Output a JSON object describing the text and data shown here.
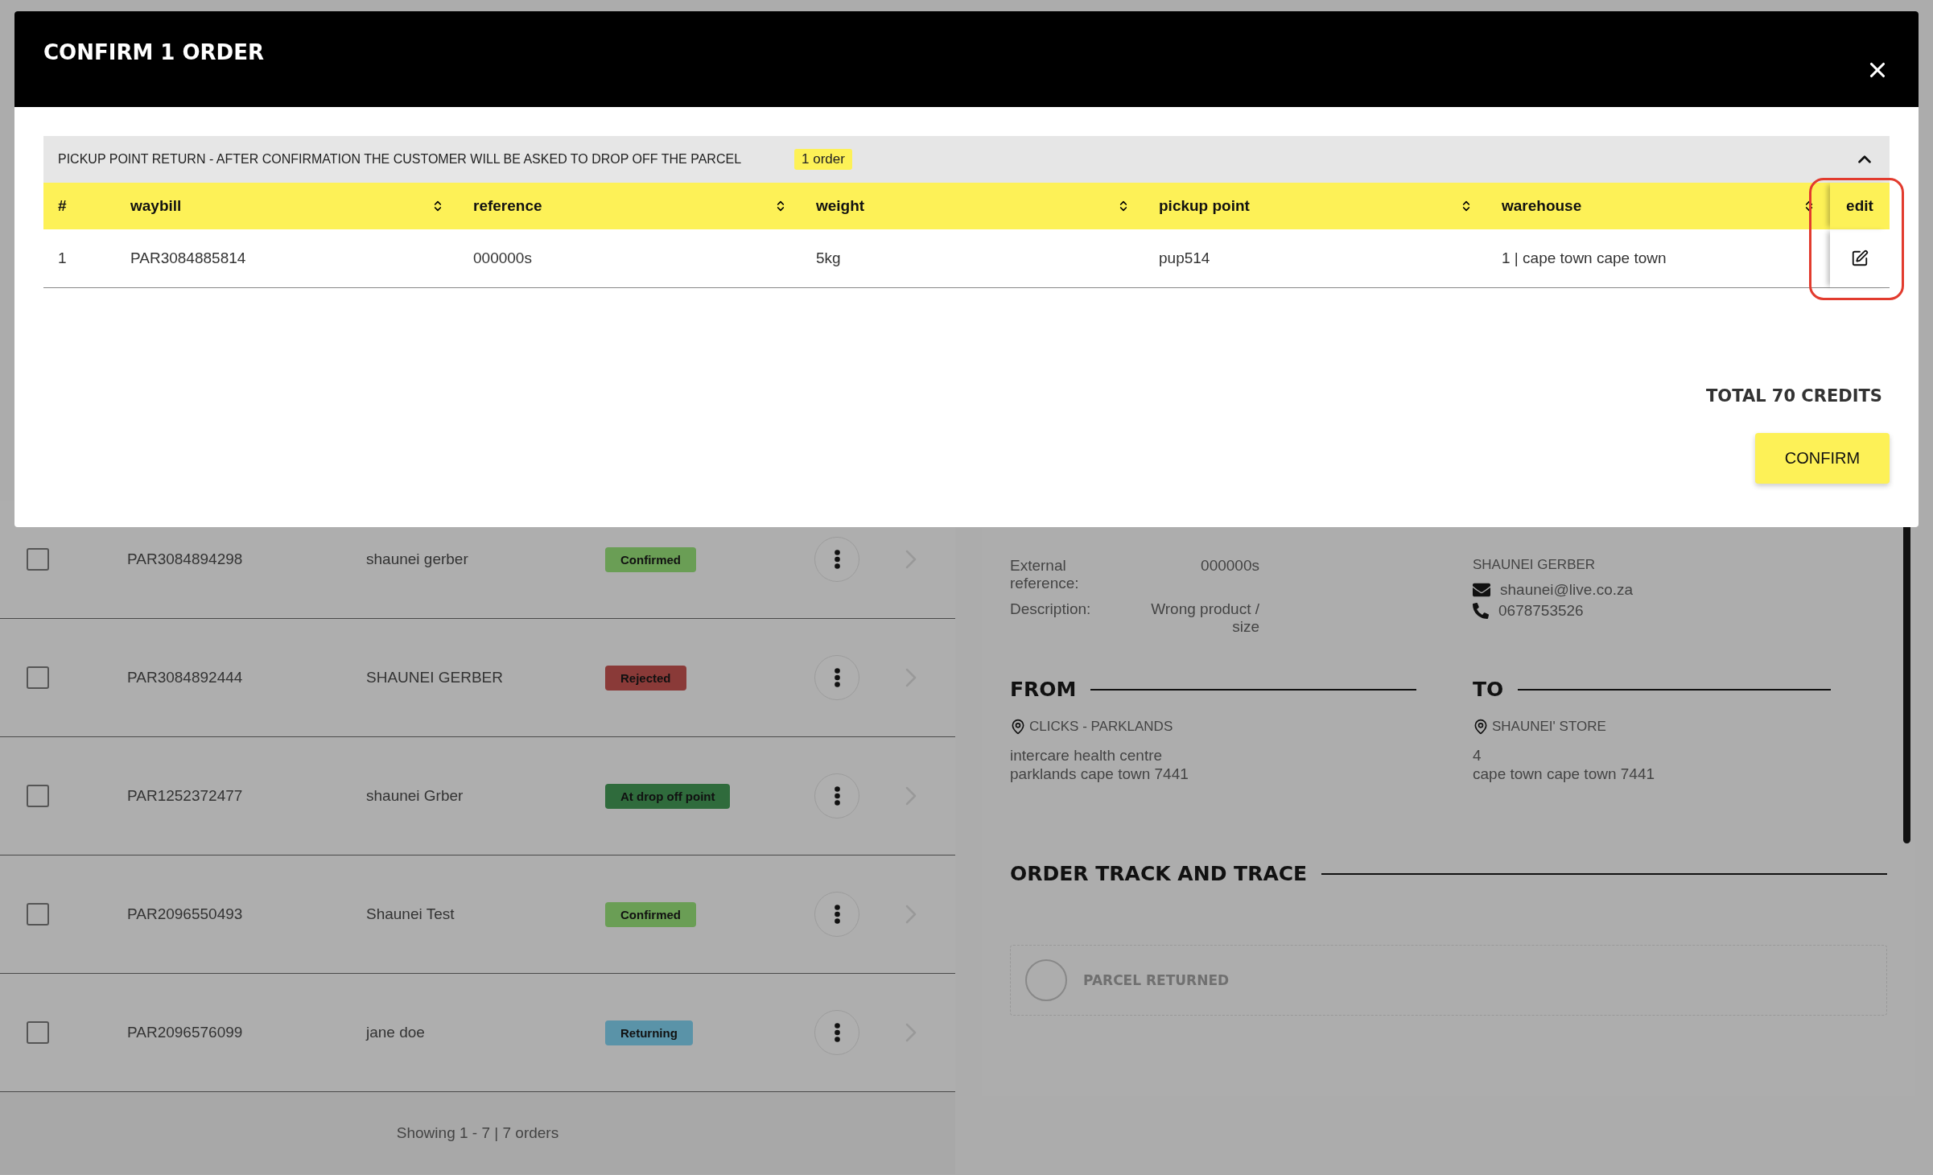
{
  "dialog": {
    "title": "CONFIRM 1 ORDER",
    "group": {
      "title": "PICKUP POINT RETURN - AFTER CONFIRMATION THE CUSTOMER WILL BE ASKED TO DROP OFF THE PARCEL",
      "count": "1 order",
      "expanded": true,
      "columns": [
        {
          "label": "#",
          "sortable": false
        },
        {
          "label": "waybill",
          "sortable": true
        },
        {
          "label": "reference",
          "sortable": true
        },
        {
          "label": "weight",
          "sortable": true
        },
        {
          "label": "pickup point",
          "sortable": true
        },
        {
          "label": "warehouse",
          "sortable": true
        },
        {
          "label": "edit",
          "sortable": false
        }
      ],
      "rows": [
        {
          "cells": [
            "1",
            "PAR3084885814",
            "000000s",
            "5kg",
            "pup514",
            "1 | cape town cape town"
          ]
        }
      ]
    },
    "total": "TOTAL 70 CREDITS",
    "confirm": "CONFIRM"
  },
  "orders": [
    {
      "waybill": "PAR3084894298",
      "name": "shaunei gerber",
      "status": "Confirmed",
      "color": "#6a9e55",
      "checked": false
    },
    {
      "waybill": "PAR3084892444",
      "name": "SHAUNEI GERBER",
      "status": "Rejected",
      "color": "#8a3a38",
      "checked": false
    },
    {
      "waybill": "PAR1252372477",
      "name": "shaunei Grber",
      "status": "At drop off point",
      "color": "#2f6b3c",
      "checked": false
    },
    {
      "waybill": "PAR2096550493",
      "name": "Shaunei Test",
      "status": "Confirmed",
      "color": "#6a9e55",
      "checked": false
    },
    {
      "waybill": "PAR2096576099",
      "name": "jane doe",
      "status": "Returning",
      "color": "#5a93a8",
      "checked": false
    }
  ],
  "footer": "Showing 1 - 7 | 7 orders",
  "details": {
    "order": [
      {
        "label": "External reference:",
        "value": "000000s"
      },
      {
        "label": "Description:",
        "value": "Wrong product / size"
      }
    ],
    "customer": {
      "name": "SHAUNEI GERBER",
      "email": "shaunei@live.co.za",
      "phone": "0678753526"
    },
    "from": {
      "title": "FROM",
      "place": "CLICKS - PARKLANDS",
      "address": [
        "intercare health centre",
        "parklands cape town 7441"
      ]
    },
    "to": {
      "title": "TO",
      "place": "SHAUNEI' STORE",
      "address": [
        "4",
        "cape town cape town 7441"
      ]
    },
    "track": {
      "title": "ORDER TRACK AND TRACE",
      "steps": [
        {
          "label": "PARCEL RETURNED"
        }
      ]
    }
  }
}
